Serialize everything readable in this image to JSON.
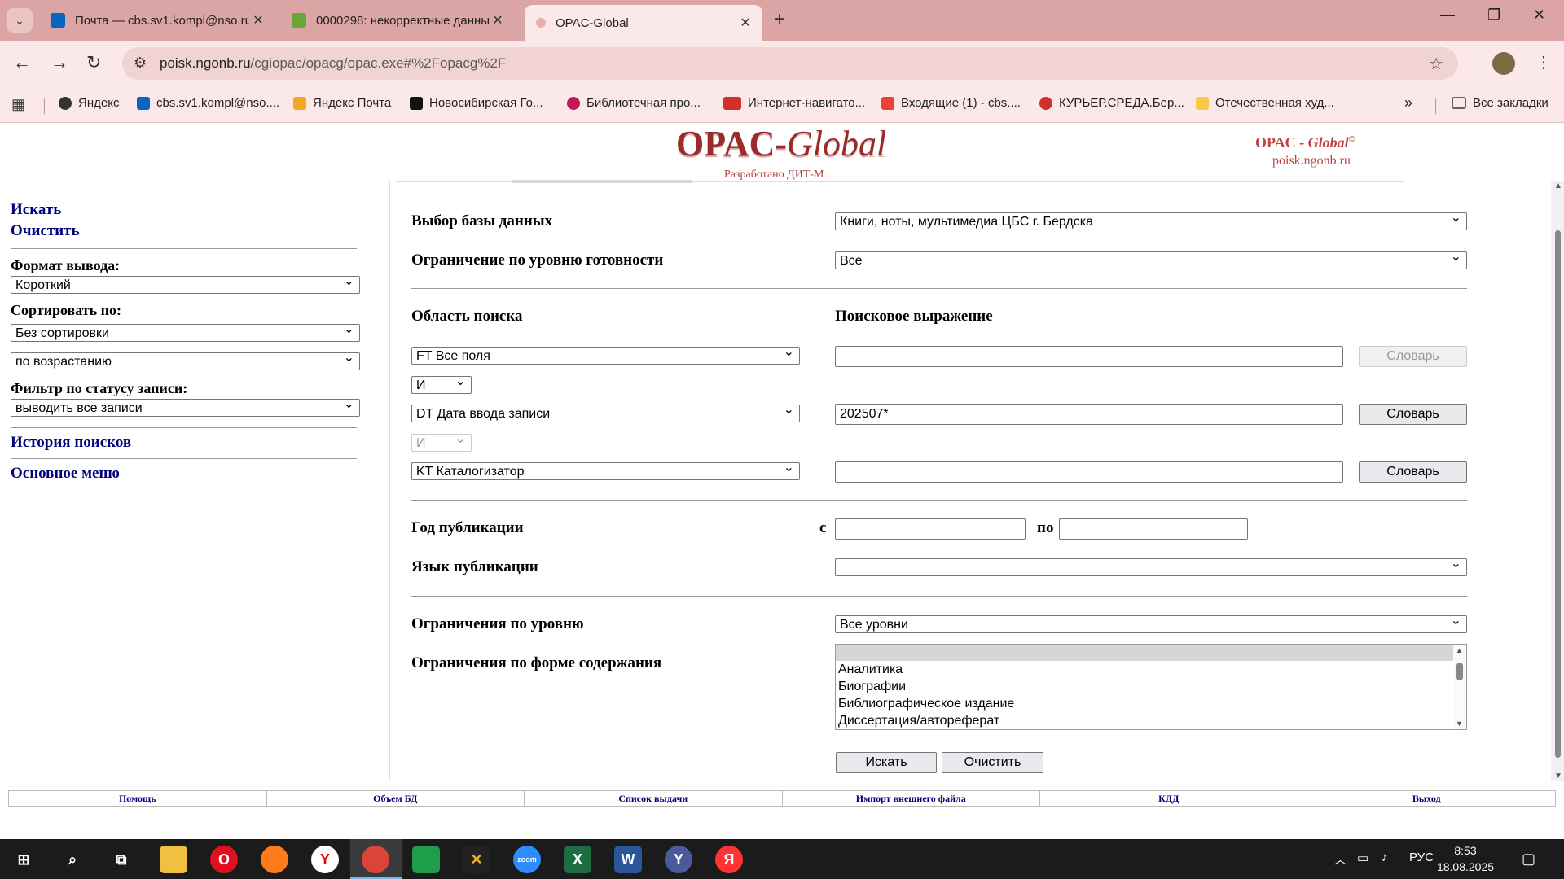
{
  "browser": {
    "tabs": [
      {
        "title": "Почта — cbs.sv1.kompl@nso.ru",
        "icon": "outlook-icon",
        "color": "#0a64c8"
      },
      {
        "title": "0000298: некорректные данные",
        "icon": "bug-icon",
        "color": "#6aa53a"
      },
      {
        "title": "OPAC-Global",
        "icon": "opac-icon",
        "color": "#c77"
      }
    ],
    "url_host": "poisk.ngonb.ru",
    "url_path": "/cgiopac/opacg/opac.exe#%2Fopacg%2F",
    "bookmarks": [
      {
        "label": "Яндекс",
        "color": "#333"
      },
      {
        "label": "cbs.sv1.kompl@nso....",
        "color": "#0a64c8"
      },
      {
        "label": "Яндекс Почта",
        "color": "#f5a623"
      },
      {
        "label": "Новосибирская Го...",
        "color": "#111"
      },
      {
        "label": "Библиотечная про...",
        "color": "#c2185b"
      },
      {
        "label": "Интернет-навигато...",
        "color": "#d32f2f"
      },
      {
        "label": "Входящие (1) - cbs....",
        "color": "#ea4335"
      },
      {
        "label": "КУРЬЕР.СРЕДА.Бер...",
        "color": "#d32f2f"
      },
      {
        "label": "Отечественная худ...",
        "color": "#f7c948"
      }
    ],
    "all_bookmarks": "Все закладки"
  },
  "header": {
    "logo_main": "OPAC-",
    "logo_italic": "Global",
    "logo_sub": "Разработано ДИТ-М",
    "right_title": "OPAC - ",
    "right_title_italic": "Global",
    "right_copy": "©",
    "right_site": "poisk.ngonb.ru"
  },
  "sidebar": {
    "search": "Искать",
    "clear": "Очистить",
    "format_label": "Формат вывода:",
    "format_value": "Короткий",
    "sort_label": "Сортировать по:",
    "sort_value": "Без сортировки",
    "order_value": "по возрастанию",
    "filter_label": "Фильтр по статусу записи:",
    "filter_value": "выводить все записи",
    "history": "История поисков",
    "main_menu": "Основное меню"
  },
  "form": {
    "db_label": "Выбор базы данных",
    "db_value": "Книги, ноты, мультимедиа ЦБС г. Бердска",
    "ready_label": "Ограничение по уровню готовности",
    "ready_value": "Все",
    "area_label": "Область поиска",
    "expr_label": "Поисковое выражение",
    "rows": [
      {
        "field": "FT Все поля",
        "value": "",
        "dict": "Словарь",
        "dict_disabled": true
      },
      {
        "field": "DT Дата ввода записи",
        "value": "202507*",
        "dict": "Словарь",
        "dict_disabled": false
      },
      {
        "field": "KT Каталогизатор",
        "value": "",
        "dict": "Словарь",
        "dict_disabled": false
      }
    ],
    "ops": [
      "И",
      "И"
    ],
    "year_label": "Год публикации",
    "year_from": "с",
    "year_to": "по",
    "lang_label": "Язык публикации",
    "lang_value": "",
    "level_label": "Ограничения по уровню",
    "level_value": "Все уровни",
    "content_label": "Ограничения по форме содержания",
    "content_options": [
      "",
      "Аналитика",
      "Биографии",
      "Библиографическое издание",
      "Диссертация/автореферат"
    ],
    "search_btn": "Искать",
    "clear_btn": "Очистить"
  },
  "footer": [
    "Помощь",
    "Объем БД",
    "Список выдачи",
    "Импорт внешнего файла",
    "КДД",
    "Выход"
  ],
  "taskbar": {
    "lang": "РУС",
    "time": "8:53",
    "date": "18.08.2025"
  }
}
